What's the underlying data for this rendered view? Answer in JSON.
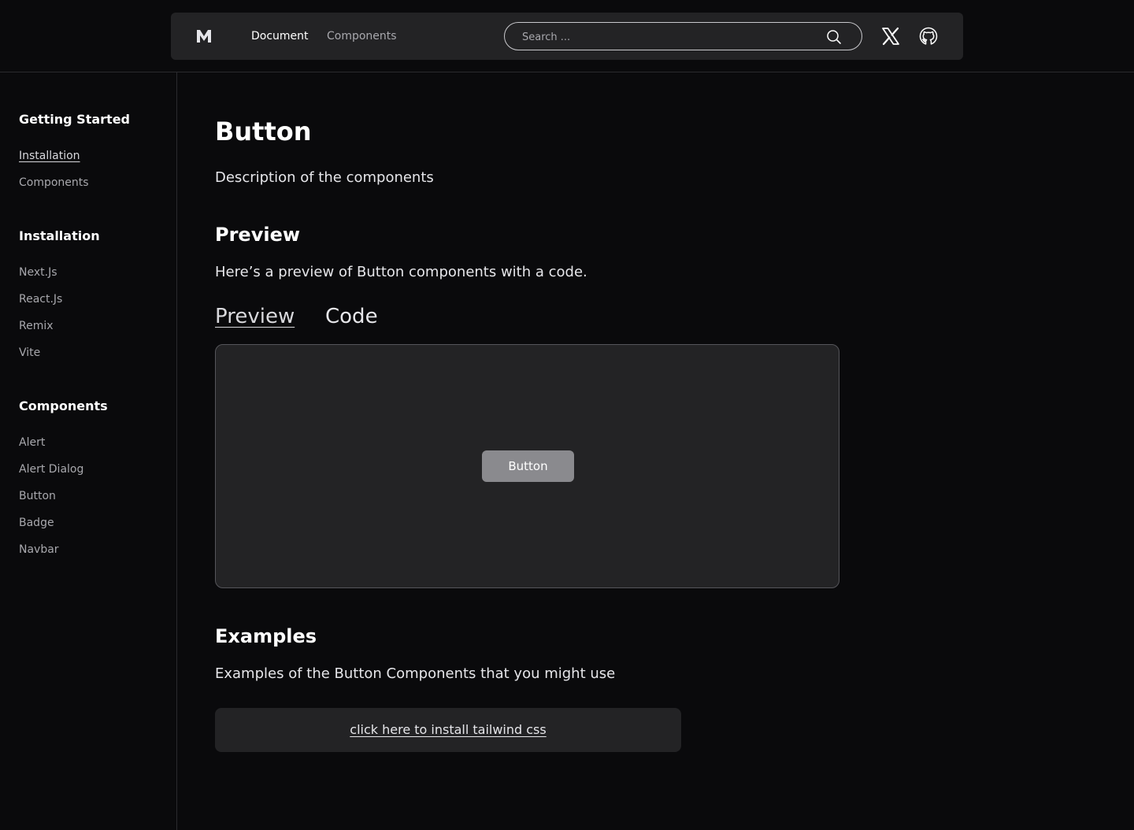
{
  "header": {
    "logo_letter": "M",
    "nav": [
      {
        "label": "Document"
      },
      {
        "label": "Components"
      }
    ],
    "search": {
      "placeholder": "Search ...",
      "value": ""
    },
    "icons": [
      "search-icon",
      "x-icon",
      "github-icon"
    ]
  },
  "sidebar": {
    "sections": [
      {
        "heading": "Getting Started",
        "items": [
          {
            "label": "Installation",
            "active": true
          },
          {
            "label": "Components"
          }
        ]
      },
      {
        "heading": "Installation",
        "items": [
          {
            "label": "Next.Js"
          },
          {
            "label": "React.Js"
          },
          {
            "label": "Remix"
          },
          {
            "label": "Vite"
          }
        ]
      },
      {
        "heading": "Components",
        "items": [
          {
            "label": "Alert"
          },
          {
            "label": "Alert Dialog"
          },
          {
            "label": "Button"
          },
          {
            "label": "Badge"
          },
          {
            "label": "Navbar"
          }
        ]
      }
    ]
  },
  "main": {
    "title": "Button",
    "description": "Description of the components",
    "preview_section": {
      "title": "Preview",
      "description": "Here’s a preview of Button components with a code.",
      "tabs": [
        {
          "label": "Preview",
          "active": true
        },
        {
          "label": "Code"
        }
      ],
      "demo_button_label": "Button"
    },
    "examples_section": {
      "title": "Examples",
      "description": "Examples of the Button Components that you might use",
      "link_label": "click here to install tailwind css"
    }
  },
  "colors": {
    "background": "#0a0a0c",
    "panel": "#232325",
    "muted_text": "#a8a8ad",
    "demo_button": "#8a8a8e"
  }
}
